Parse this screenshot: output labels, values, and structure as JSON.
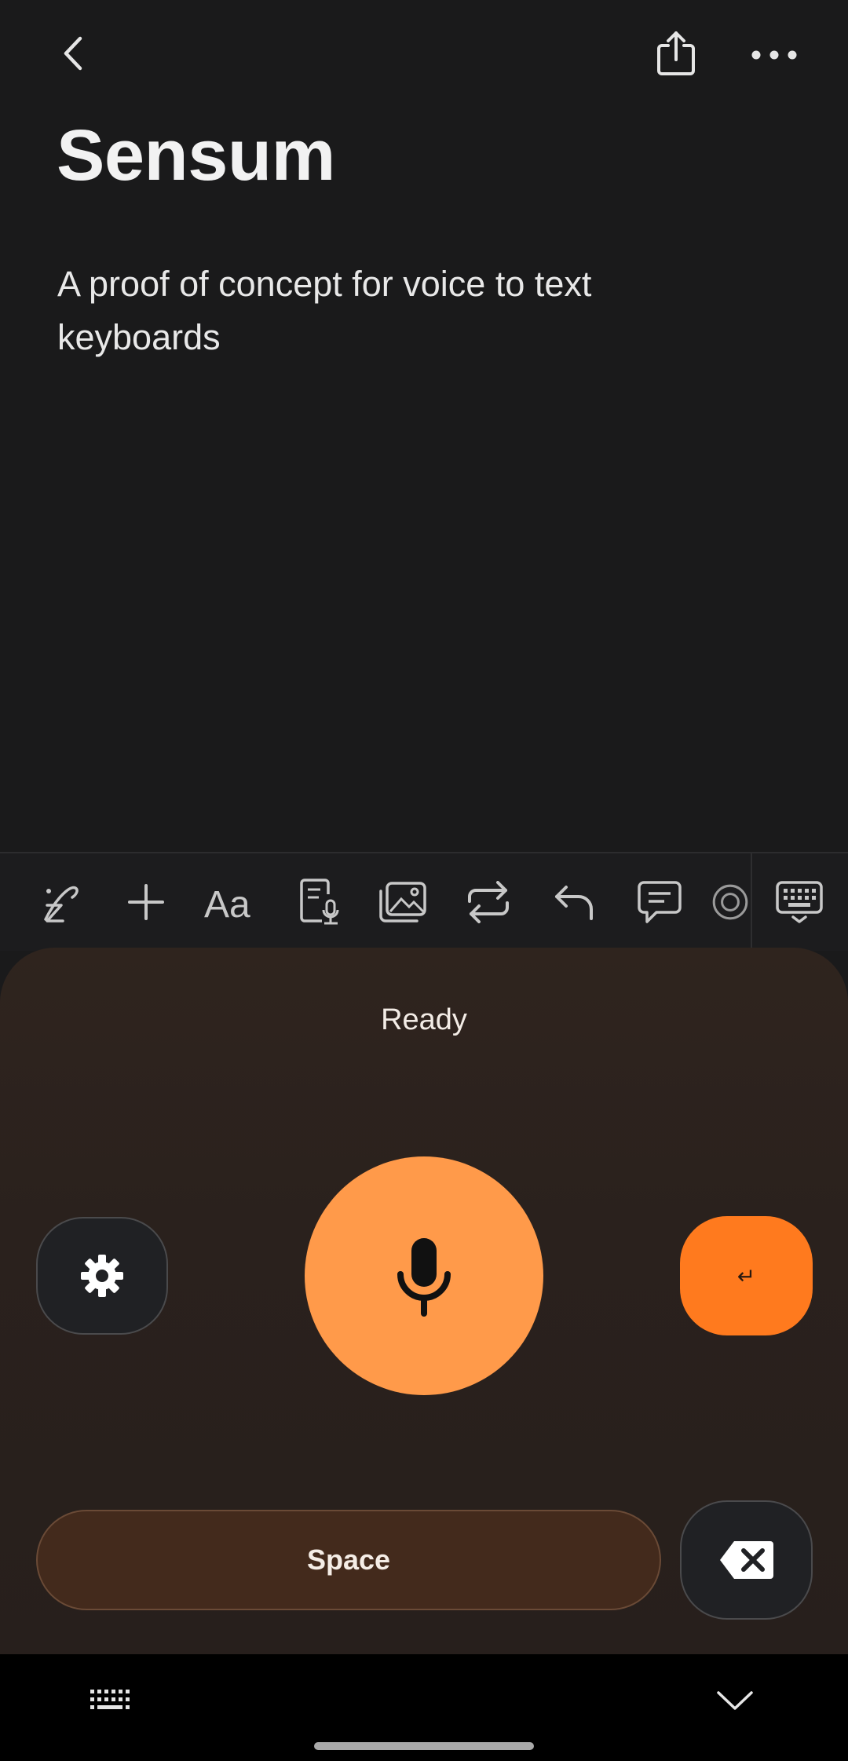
{
  "note": {
    "title": "Sensum",
    "body": "A proof of concept for voice to text keyboards"
  },
  "toolbar": {
    "tools": [
      "pen-icon",
      "add-icon",
      "text-format-icon",
      "voice-record-icon",
      "insert-image-icon",
      "convert-icon",
      "undo-icon",
      "comment-icon",
      "more-tools-icon",
      "keyboard-icon"
    ]
  },
  "keyboard": {
    "status": "Ready",
    "enter_label": "↵",
    "space_label": "Space",
    "accent_color": "#ff9a4a",
    "enter_color": "#ff7a1e"
  },
  "navbar": {
    "icons": [
      "keyboard-switch-icon",
      "hide-keyboard-icon"
    ]
  }
}
